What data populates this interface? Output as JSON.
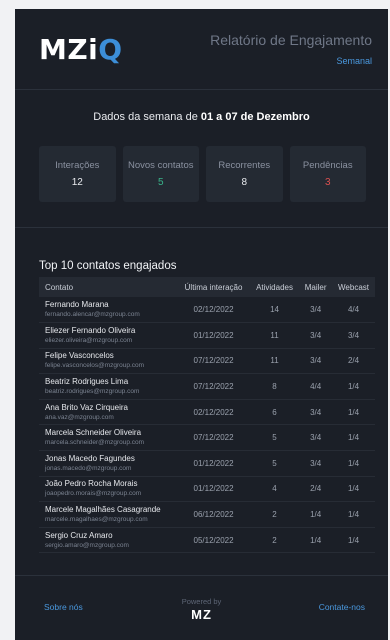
{
  "header": {
    "logo_main": "MZi",
    "logo_accent": "Q",
    "title": "Relatório de Engajamento",
    "subtitle": "Semanal"
  },
  "summary": {
    "prefix": "Dados da semana de ",
    "range": "01 a 07 de Dezembro"
  },
  "stats": [
    {
      "label": "Interações",
      "value": "12"
    },
    {
      "label": "Novos contatos",
      "value": "5"
    },
    {
      "label": "Recorrentes",
      "value": "8"
    },
    {
      "label": "Pendências",
      "value": "3"
    }
  ],
  "top": {
    "title": "Top 10 contatos engajados",
    "columns": [
      "Contato",
      "Última interação",
      "Atividades",
      "Mailer",
      "Webcast"
    ],
    "rows": [
      {
        "name": "Fernando Marana",
        "email": "fernando.alencar@mzgroup.com",
        "last": "02/12/2022",
        "activities": "14",
        "mailer": "3/4",
        "webcast": "4/4"
      },
      {
        "name": "Eliezer Fernando Oliveira",
        "email": "eliezer.oliveira@mzgroup.com",
        "last": "01/12/2022",
        "activities": "11",
        "mailer": "3/4",
        "webcast": "3/4"
      },
      {
        "name": "Felipe Vasconcelos",
        "email": "felipe.vasconcelos@mzgroup.com",
        "last": "07/12/2022",
        "activities": "11",
        "mailer": "3/4",
        "webcast": "2/4"
      },
      {
        "name": "Beatriz Rodrigues Lima",
        "email": "beatriz.rodrigues@mzgroup.com",
        "last": "07/12/2022",
        "activities": "8",
        "mailer": "4/4",
        "webcast": "1/4"
      },
      {
        "name": "Ana Brito Vaz Cirqueira",
        "email": "ana.vaz@mzgroup.com",
        "last": "02/12/2022",
        "activities": "6",
        "mailer": "3/4",
        "webcast": "1/4"
      },
      {
        "name": "Marcela Schneider Oliveira",
        "email": "marcela.schneider@mzgroup.com",
        "last": "07/12/2022",
        "activities": "5",
        "mailer": "3/4",
        "webcast": "1/4"
      },
      {
        "name": "Jonas Macedo Fagundes",
        "email": "jonas.macedo@mzgroup.com",
        "last": "01/12/2022",
        "activities": "5",
        "mailer": "3/4",
        "webcast": "1/4"
      },
      {
        "name": "João Pedro Rocha Morais",
        "email": "joaopedro.morais@mzgroup.com",
        "last": "01/12/2022",
        "activities": "4",
        "mailer": "2/4",
        "webcast": "1/4"
      },
      {
        "name": "Marcele Magalhães Casagrande",
        "email": "marcele.magalhaes@mzgroup.com",
        "last": "06/12/2022",
        "activities": "2",
        "mailer": "1/4",
        "webcast": "1/4"
      },
      {
        "name": "Sergio Cruz Amaro",
        "email": "sergio.amaro@mzgroup.com",
        "last": "05/12/2022",
        "activities": "2",
        "mailer": "1/4",
        "webcast": "1/4"
      }
    ]
  },
  "footer": {
    "about": "Sobre nós",
    "powered": "Powered by",
    "brand": "MZ",
    "contact": "Contate-nos"
  },
  "colors": {
    "background": "#1b1f27",
    "accent": "#4a98de",
    "positive": "#39b38a",
    "negative": "#d95050"
  }
}
